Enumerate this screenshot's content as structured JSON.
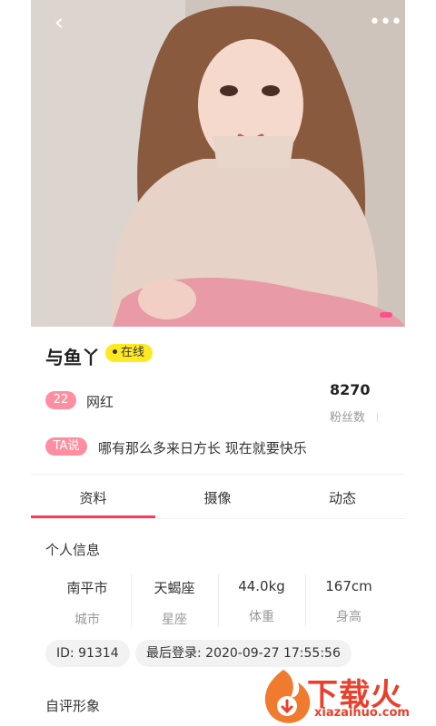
{
  "header": {
    "back_icon": "chevron-left-icon",
    "more_icon": "more-dots-icon",
    "back_glyph": "‹",
    "more_glyph": "•••"
  },
  "profile": {
    "name": "与鱼丫",
    "status": "在线",
    "age": "22",
    "tag": "网红",
    "fans_count": "8270",
    "fans_label": "粉丝数",
    "ta_badge": "TA说",
    "signature": "哪有那么多来日方长 现在就要快乐"
  },
  "tabs": [
    {
      "label": "资料",
      "active": true
    },
    {
      "label": "摄像",
      "active": false
    },
    {
      "label": "动态",
      "active": false
    }
  ],
  "personal_info": {
    "title": "个人信息",
    "cells": [
      {
        "value": "南平市",
        "label": "城市"
      },
      {
        "value": "天蝎座",
        "label": "星座"
      },
      {
        "value": "44.0kg",
        "label": "体重"
      },
      {
        "value": "167cm",
        "label": "身高"
      }
    ],
    "id_text": "ID: 91314",
    "last_login": "最后登录: 2020-09-27 17:55:56"
  },
  "self_eval": {
    "title": "自评形象"
  },
  "watermark": {
    "text": "下载火",
    "url": "xiazaihuo.com"
  },
  "colors": {
    "accent": "#ff3a5c",
    "badge_pink": "#ff8fa0",
    "online_yellow": "#ffe923",
    "watermark_red": "#e8402a"
  }
}
